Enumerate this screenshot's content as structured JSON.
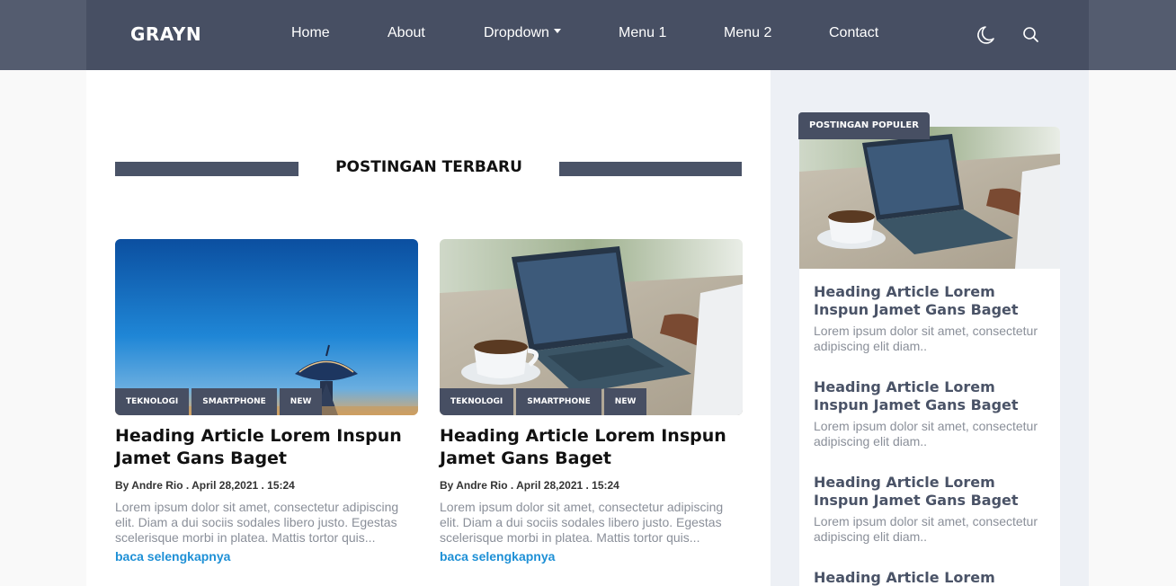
{
  "header": {
    "brand": "GRAYN",
    "nav": [
      "Home",
      "About",
      "Dropdown",
      "Menu 1",
      "Menu 2",
      "Contact"
    ],
    "icons": [
      "moon-icon",
      "search-icon"
    ]
  },
  "section": {
    "title": "POSTINGAN TERBARU"
  },
  "posts": [
    {
      "image": "radio-telescope-dusk-photo",
      "tags": [
        "TEKNOLOGI",
        "SMARTPHONE",
        "NEW"
      ],
      "title": "Heading Article Lorem Inspun Jamet Gans Baget",
      "meta": "By Andre Rio . April 28,2021 . 15:24",
      "excerpt": "Lorem ipsum dolor sit amet, consectetur adipiscing elit. Diam a dui sociis sodales libero justo. Egestas scelerisque morbi in platea. Mattis tortor quis...",
      "more": "baca selengkapnya"
    },
    {
      "image": "laptop-coffee-photo",
      "tags": [
        "TEKNOLOGI",
        "SMARTPHONE",
        "NEW"
      ],
      "title": "Heading Article Lorem Inspun Jamet Gans Baget",
      "meta": "By Andre Rio . April 28,2021 . 15:24",
      "excerpt": "Lorem ipsum dolor sit amet, consectetur adipiscing elit. Diam a dui sociis sodales libero justo. Egestas scelerisque morbi in platea. Mattis tortor quis...",
      "more": "baca selengkapnya"
    }
  ],
  "sidebar": {
    "badge": "POSTINGAN POPULER",
    "image": "laptop-coffee-photo",
    "items": [
      {
        "title": "Heading Article Lorem Inspun Jamet Gans Baget",
        "text": "Lorem ipsum dolor sit amet, consectetur adipiscing elit diam.."
      },
      {
        "title": "Heading Article Lorem Inspun Jamet Gans Baget",
        "text": "Lorem ipsum dolor sit amet, consectetur adipiscing elit diam.."
      },
      {
        "title": "Heading Article Lorem Inspun Jamet Gans Baget",
        "text": "Lorem ipsum dolor sit amet, consectetur adipiscing elit diam.."
      },
      {
        "title": "Heading Article Lorem",
        "text": ""
      }
    ]
  },
  "colors": {
    "header_bg": "#474f63",
    "header_outer": "#545c6f",
    "accent_dark": "#4a5367",
    "link": "#1e90d6",
    "sidebar_bg": "#edf0f5"
  }
}
